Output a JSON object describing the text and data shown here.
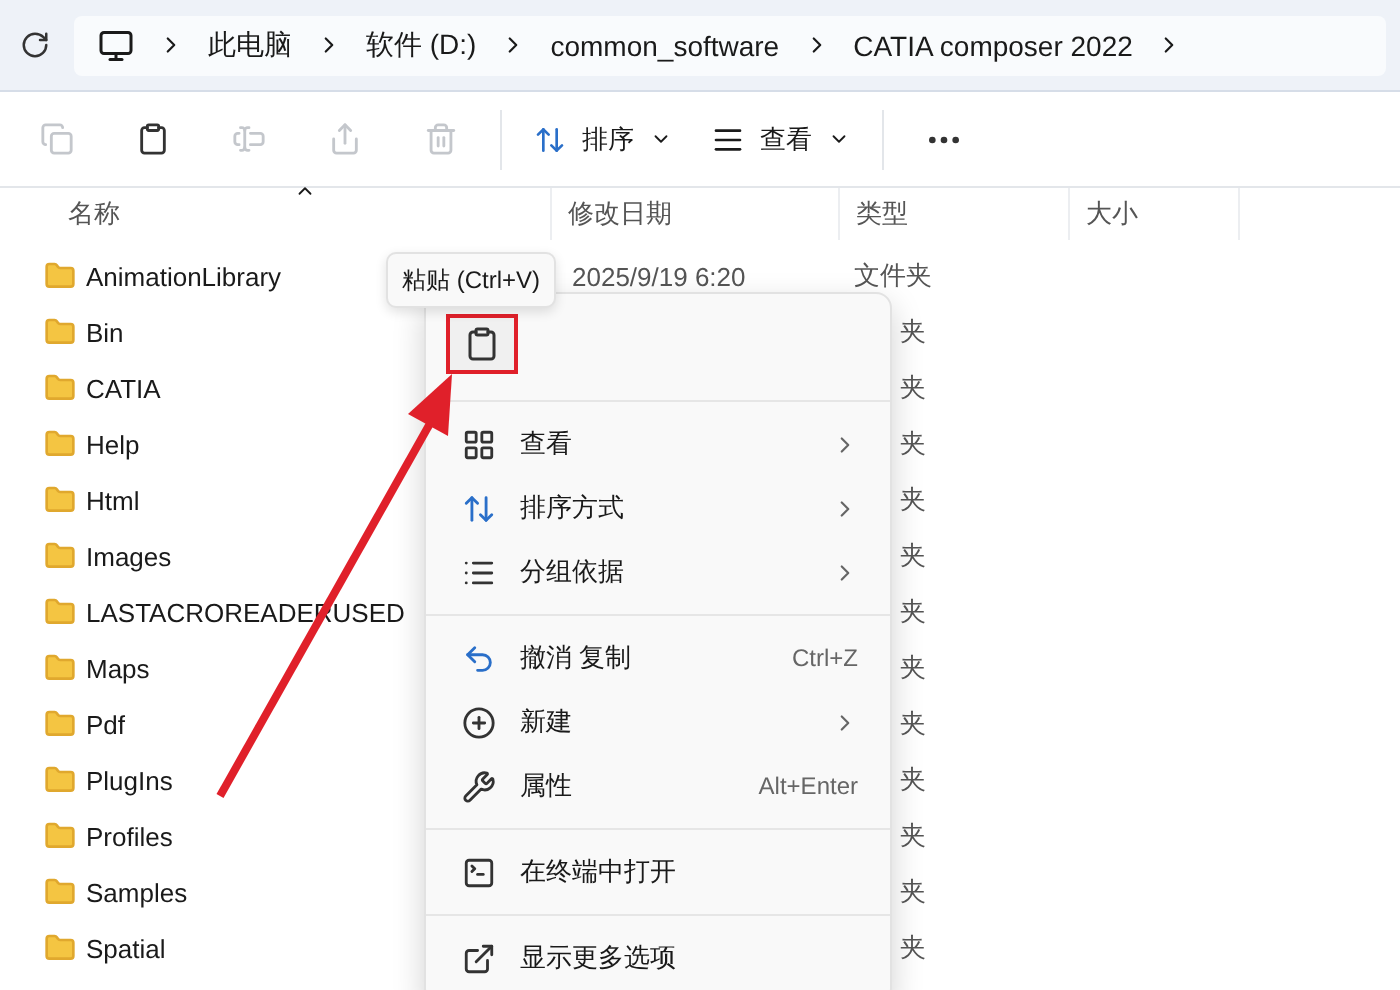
{
  "address_bar": {
    "breadcrumbs": [
      "此电脑",
      "软件 (D:)",
      "common_software",
      "CATIA composer 2022"
    ]
  },
  "toolbar": {
    "icon_buttons": [
      {
        "disabled": true
      },
      {
        "disabled": false
      },
      {
        "disabled": true
      },
      {
        "disabled": true
      },
      {
        "disabled": true
      }
    ],
    "sort": {
      "label": "排序"
    },
    "view": {
      "label": "查看"
    }
  },
  "columns": [
    "名称",
    "修改日期",
    "类型",
    "大小"
  ],
  "rows": [
    {
      "name": "AnimationLibrary",
      "date": "2025/9/19 6:20",
      "type": "文件夹"
    },
    {
      "name": "Bin",
      "type": "夹"
    },
    {
      "name": "CATIA",
      "type": "夹"
    },
    {
      "name": "Help",
      "type": "夹"
    },
    {
      "name": "Html",
      "type": "夹"
    },
    {
      "name": "Images",
      "type": "夹"
    },
    {
      "name": "LASTACROREADERUSED",
      "type": "夹"
    },
    {
      "name": "Maps",
      "type": "夹"
    },
    {
      "name": "Pdf",
      "type": "夹"
    },
    {
      "name": "PlugIns",
      "type": "夹"
    },
    {
      "name": "Profiles",
      "type": "夹"
    },
    {
      "name": "Samples",
      "type": "夹"
    },
    {
      "name": "Spatial",
      "type": "夹"
    }
  ],
  "tooltip": "粘贴 (Ctrl+V)",
  "context_menu": {
    "items": [
      {
        "kind": "paste"
      },
      {
        "kind": "divider"
      },
      {
        "kind": "item",
        "label": "查看",
        "submenu": true
      },
      {
        "kind": "item",
        "label": "排序方式",
        "submenu": true
      },
      {
        "kind": "item",
        "label": "分组依据",
        "submenu": true
      },
      {
        "kind": "divider"
      },
      {
        "kind": "item",
        "label": "撤消 复制",
        "shortcut": "Ctrl+Z",
        "submenu": false
      },
      {
        "kind": "item",
        "label": "新建",
        "submenu": true
      },
      {
        "kind": "item",
        "label": "属性",
        "shortcut": "Alt+Enter",
        "submenu": false
      },
      {
        "kind": "divider"
      },
      {
        "kind": "item",
        "label": "在终端中打开",
        "submenu": false
      },
      {
        "kind": "divider"
      },
      {
        "kind": "item",
        "label": "显示更多选项",
        "submenu": false
      }
    ]
  }
}
